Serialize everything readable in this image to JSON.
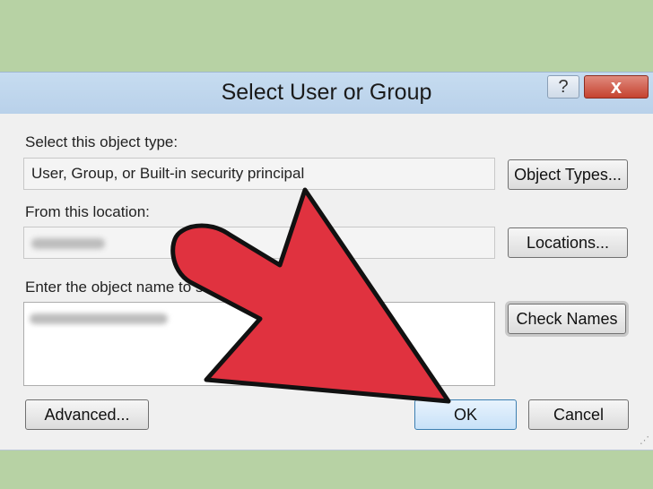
{
  "window": {
    "title": "Select User or Group",
    "help_glyph": "?",
    "close_glyph": "x"
  },
  "object_type": {
    "label": "Select this object type:",
    "value": "User, Group, or Built-in security principal",
    "button": "Object Types..."
  },
  "location": {
    "label": "From this location:",
    "button": "Locations..."
  },
  "object_name": {
    "label": "Enter the object name to se",
    "button": "Check Names"
  },
  "footer": {
    "advanced": "Advanced...",
    "ok": "OK",
    "cancel": "Cancel"
  },
  "colors": {
    "background": "#b7d2a4",
    "arrow_fill": "#e0323f",
    "arrow_stroke": "#111111",
    "close_button": "#c5422f"
  },
  "overlay": {
    "icon": "pointer-arrow"
  }
}
